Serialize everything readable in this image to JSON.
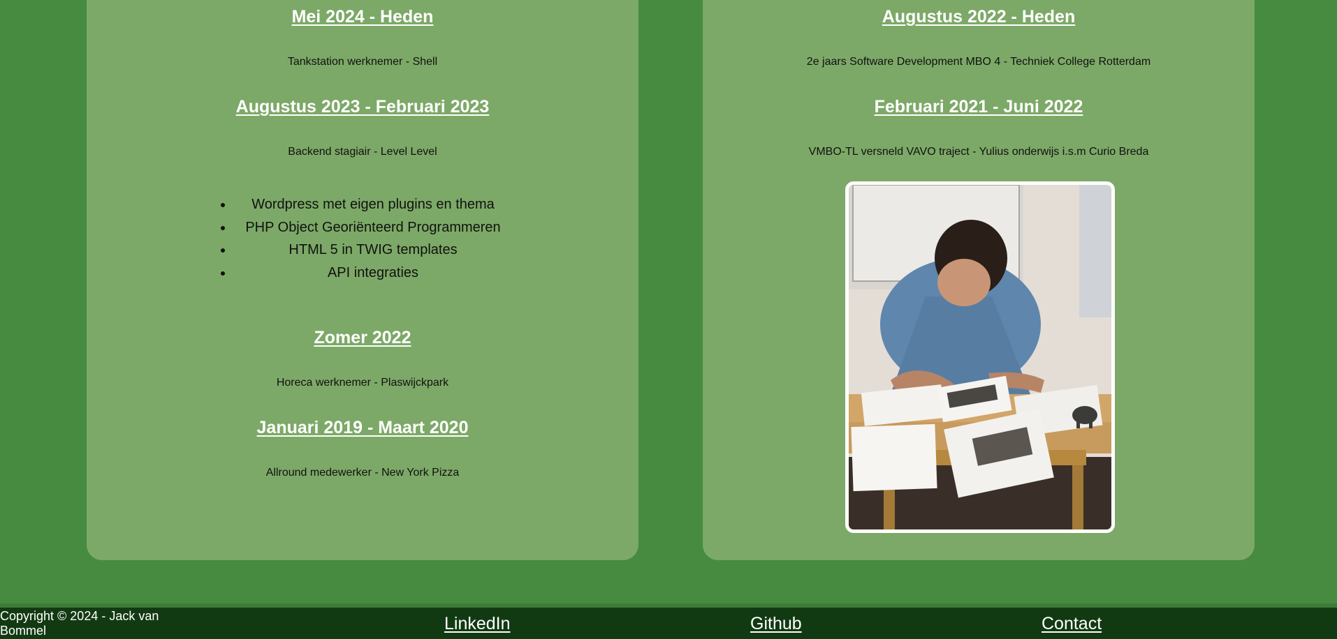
{
  "experience": {
    "items": [
      {
        "period": "Mei 2024 - Heden",
        "role": "Tankstation werknemer - Shell"
      },
      {
        "period": "Augustus 2023 - Februari 2023",
        "role": "Backend stagiair - Level Level",
        "skills": [
          "Wordpress met eigen plugins en thema",
          "PHP Object Georiënteerd Programmeren",
          "HTML 5 in TWIG templates",
          "API integraties"
        ]
      },
      {
        "period": "Zomer 2022",
        "role": "Horeca werknemer - Plaswijckpark"
      },
      {
        "period": "Januari 2019 - Maart 2020",
        "role": "Allround medewerker - New York Pizza"
      }
    ]
  },
  "education": {
    "items": [
      {
        "period": "Augustus 2022 - Heden",
        "role": "2e jaars Software Development MBO 4 - Techniek College Rotterdam"
      },
      {
        "period": "Februari 2021 - Juni 2022",
        "role": "VMBO-TL versneld VAVO traject - Yulius onderwijs i.s.m Curio Breda"
      }
    ],
    "photo": "student-writing-at-desk-photo"
  },
  "footer": {
    "copyright": "Copyright © 2024 - Jack van Bommel",
    "links": {
      "linkedin": "LinkedIn",
      "github": "Github",
      "contact": "Contact"
    }
  },
  "colors": {
    "page_bg": "#468b40",
    "panel_bg": "#7ca967",
    "footer_bg": "#123a12",
    "heading": "#ffffff"
  }
}
